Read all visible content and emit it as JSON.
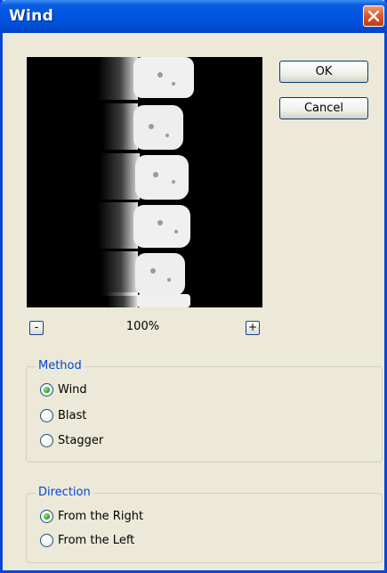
{
  "window": {
    "title": "Wind"
  },
  "buttons": {
    "ok": "OK",
    "cancel": "Cancel"
  },
  "preview": {
    "zoom_out": "-",
    "zoom_in": "+",
    "zoom_level": "100%"
  },
  "method": {
    "legend": "Method",
    "options": [
      "Wind",
      "Blast",
      "Stagger"
    ],
    "selected": "Wind"
  },
  "direction": {
    "legend": "Direction",
    "options": [
      "From the Right",
      "From the Left"
    ],
    "selected": "From the Right"
  },
  "colors": {
    "titlebar": "#0054e3",
    "group_legend": "#0046d5",
    "dialog_bg": "#ece9d8"
  }
}
